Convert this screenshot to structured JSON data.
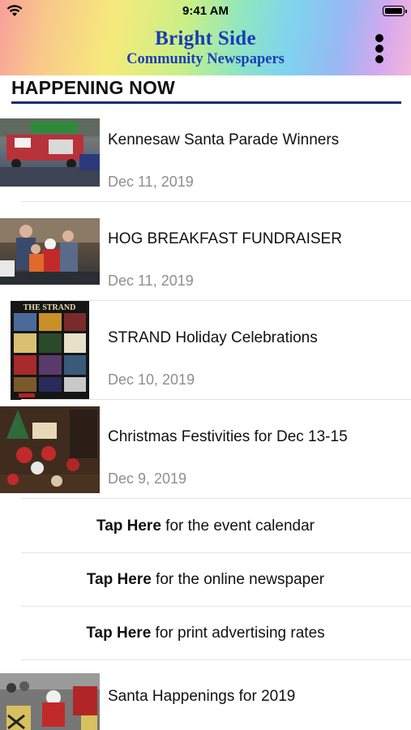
{
  "status_bar": {
    "time": "9:41 AM"
  },
  "header": {
    "title": "Bright Side",
    "subtitle": "Community Newspapers"
  },
  "section": {
    "title": "HAPPENING NOW"
  },
  "articles": [
    {
      "headline": "Kennesaw Santa Parade Winners",
      "date": "Dec 11, 2019"
    },
    {
      "headline": "HOG BREAKFAST FUNDRAISER",
      "date": "Dec 11, 2019"
    },
    {
      "headline": "STRAND Holiday Celebrations",
      "date": "Dec 10, 2019"
    },
    {
      "headline": "Christmas Festivities for Dec 13-15",
      "date": "Dec 9, 2019"
    },
    {
      "headline": "Santa Happenings for 2019"
    }
  ],
  "links": [
    {
      "bold": "Tap Here",
      "rest": " for the event calendar"
    },
    {
      "bold": "Tap Here",
      "rest": " for the online newspaper"
    },
    {
      "bold": "Tap Here",
      "rest": " for print advertising rates"
    }
  ],
  "thumbnails": {
    "strand_poster_title": "THE STRAND"
  },
  "colors": {
    "brand_blue": "#1a3cb8",
    "rule_navy": "#1a2a78",
    "date_gray": "#8e8e93"
  }
}
